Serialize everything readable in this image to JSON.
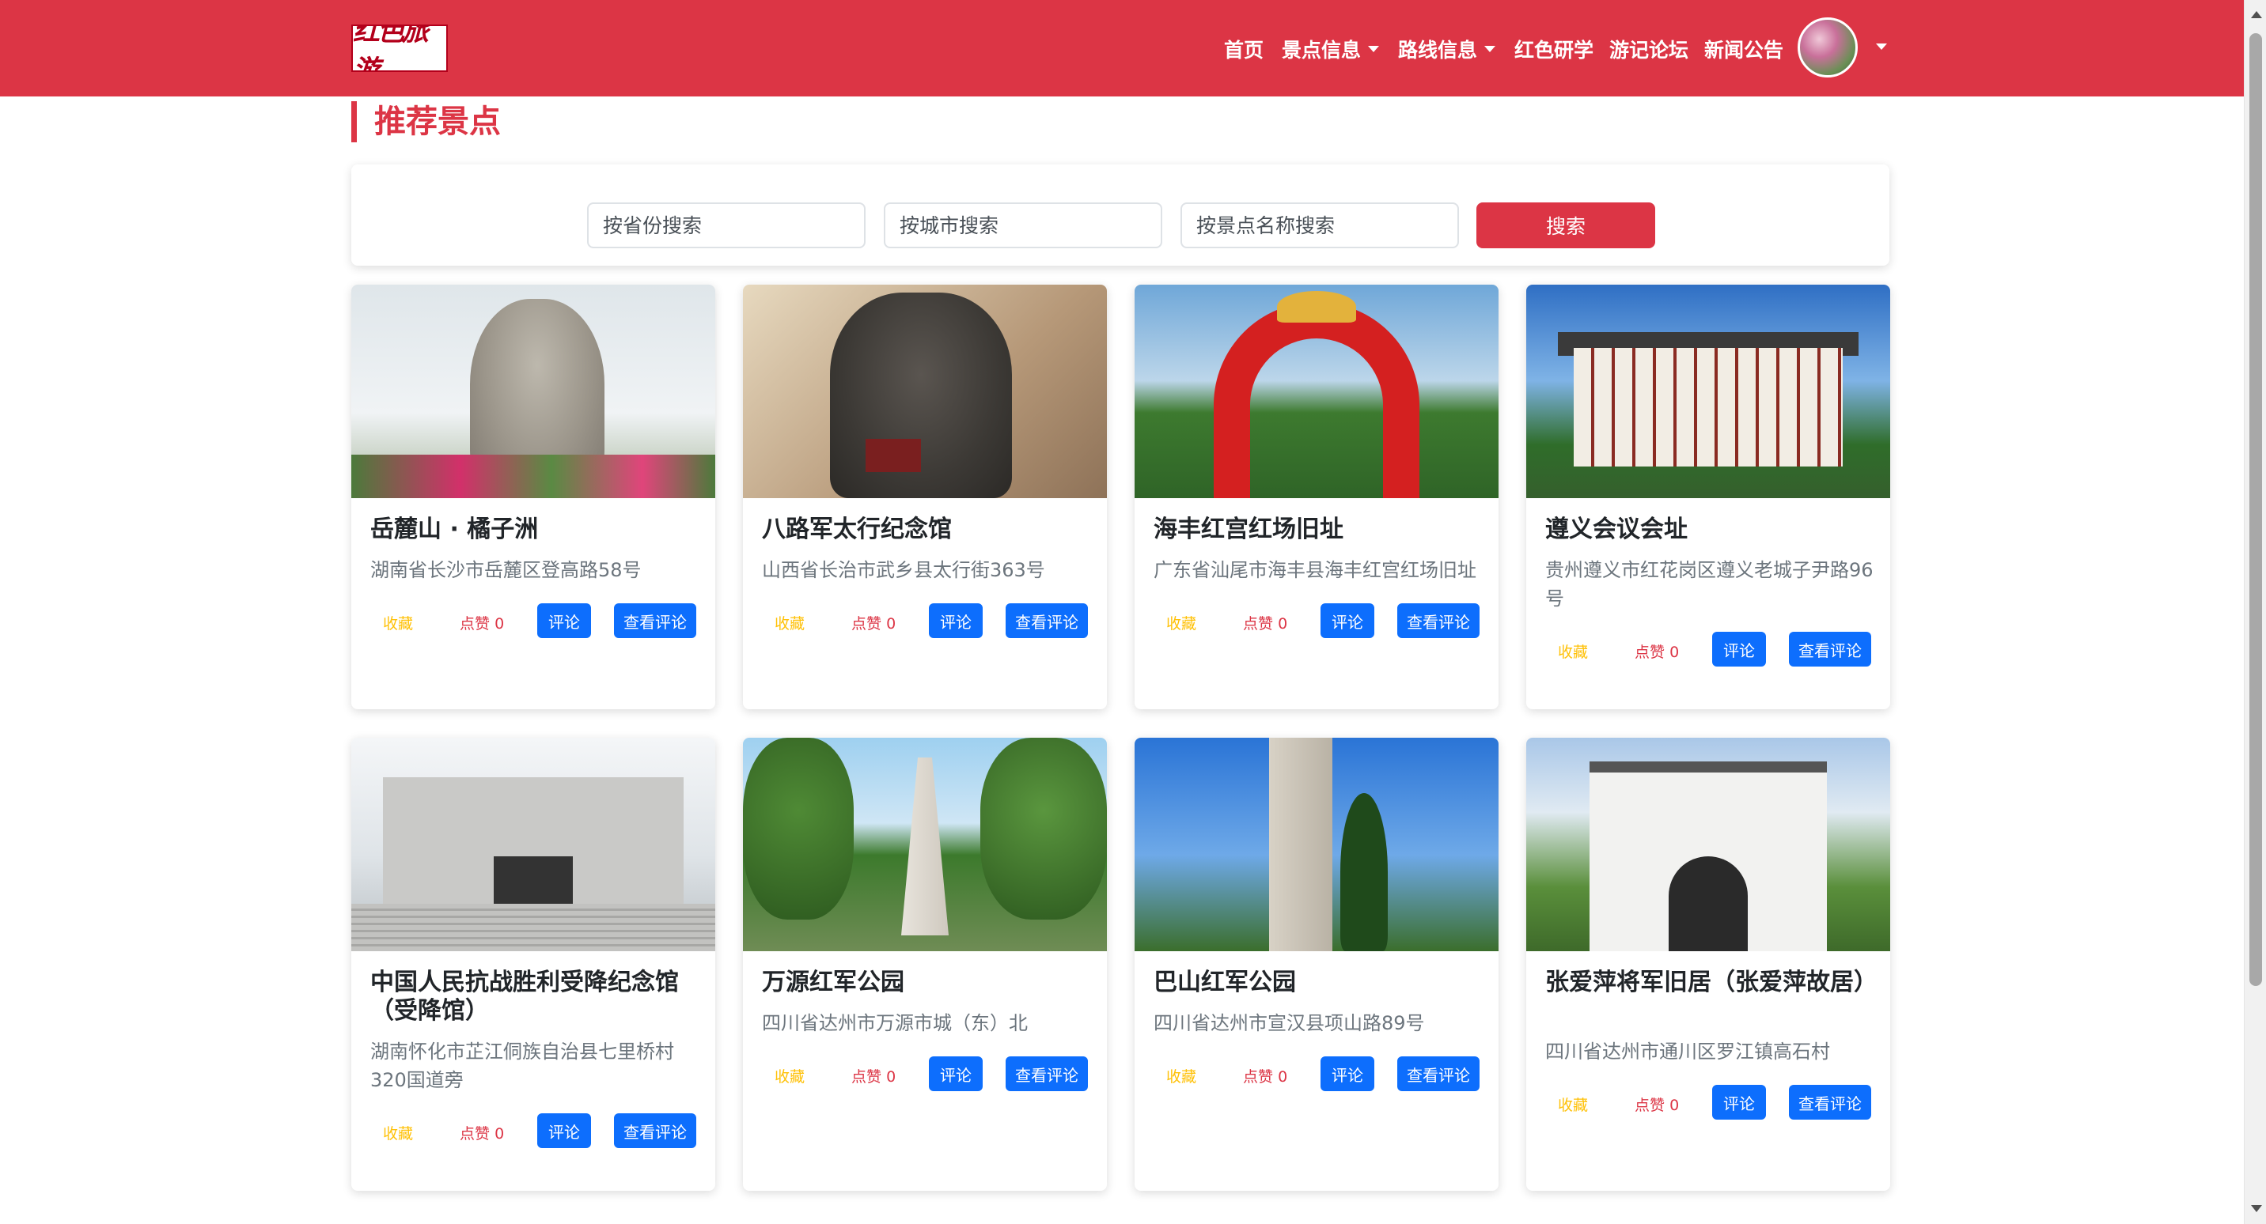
{
  "navbar": {
    "logo_text": "红色旅游",
    "items": [
      {
        "label": "首页"
      },
      {
        "label": "景点信息"
      },
      {
        "label": "路线信息"
      },
      {
        "label": "红色研学"
      },
      {
        "label": "游记论坛"
      },
      {
        "label": "新闻公告"
      }
    ],
    "bg_color": "#dc3545"
  },
  "page": {
    "section_title": "推荐景点"
  },
  "search": {
    "province_placeholder": "按省份搜索",
    "city_placeholder": "按城市搜索",
    "name_placeholder": "按景点名称搜索",
    "button_label": "搜索"
  },
  "actions": {
    "favorite": "收藏",
    "like_prefix": "点赞",
    "comment": "评论",
    "view_comments": "查看评论"
  },
  "attractions": [
    {
      "name": "岳麓山 · 橘子洲",
      "address": "湖南省长沙市岳麓区登高路58号",
      "likes": 0
    },
    {
      "name": "八路军太行纪念馆",
      "address": "山西省长治市武乡县太行街363号",
      "likes": 0
    },
    {
      "name": "海丰红宫红场旧址",
      "address": "广东省汕尾市海丰县海丰红宫红场旧址",
      "likes": 0
    },
    {
      "name": "遵义会议会址",
      "address": "贵州遵义市红花岗区遵义老城子尹路96号",
      "likes": 0
    },
    {
      "name": "中国人民抗战胜利受降纪念馆（受降馆）",
      "address": "湖南怀化市芷江侗族自治县七里桥村320国道旁",
      "likes": 0
    },
    {
      "name": "万源红军公园",
      "address": "四川省达州市万源市城（东）北",
      "likes": 0
    },
    {
      "name": "巴山红军公园",
      "address": "四川省达州市宣汉县项山路89号",
      "likes": 0
    },
    {
      "name": "张爱萍将军旧居（张爱萍故居）",
      "address": "四川省达州市通川区罗江镇高石村",
      "likes": 0
    }
  ]
}
